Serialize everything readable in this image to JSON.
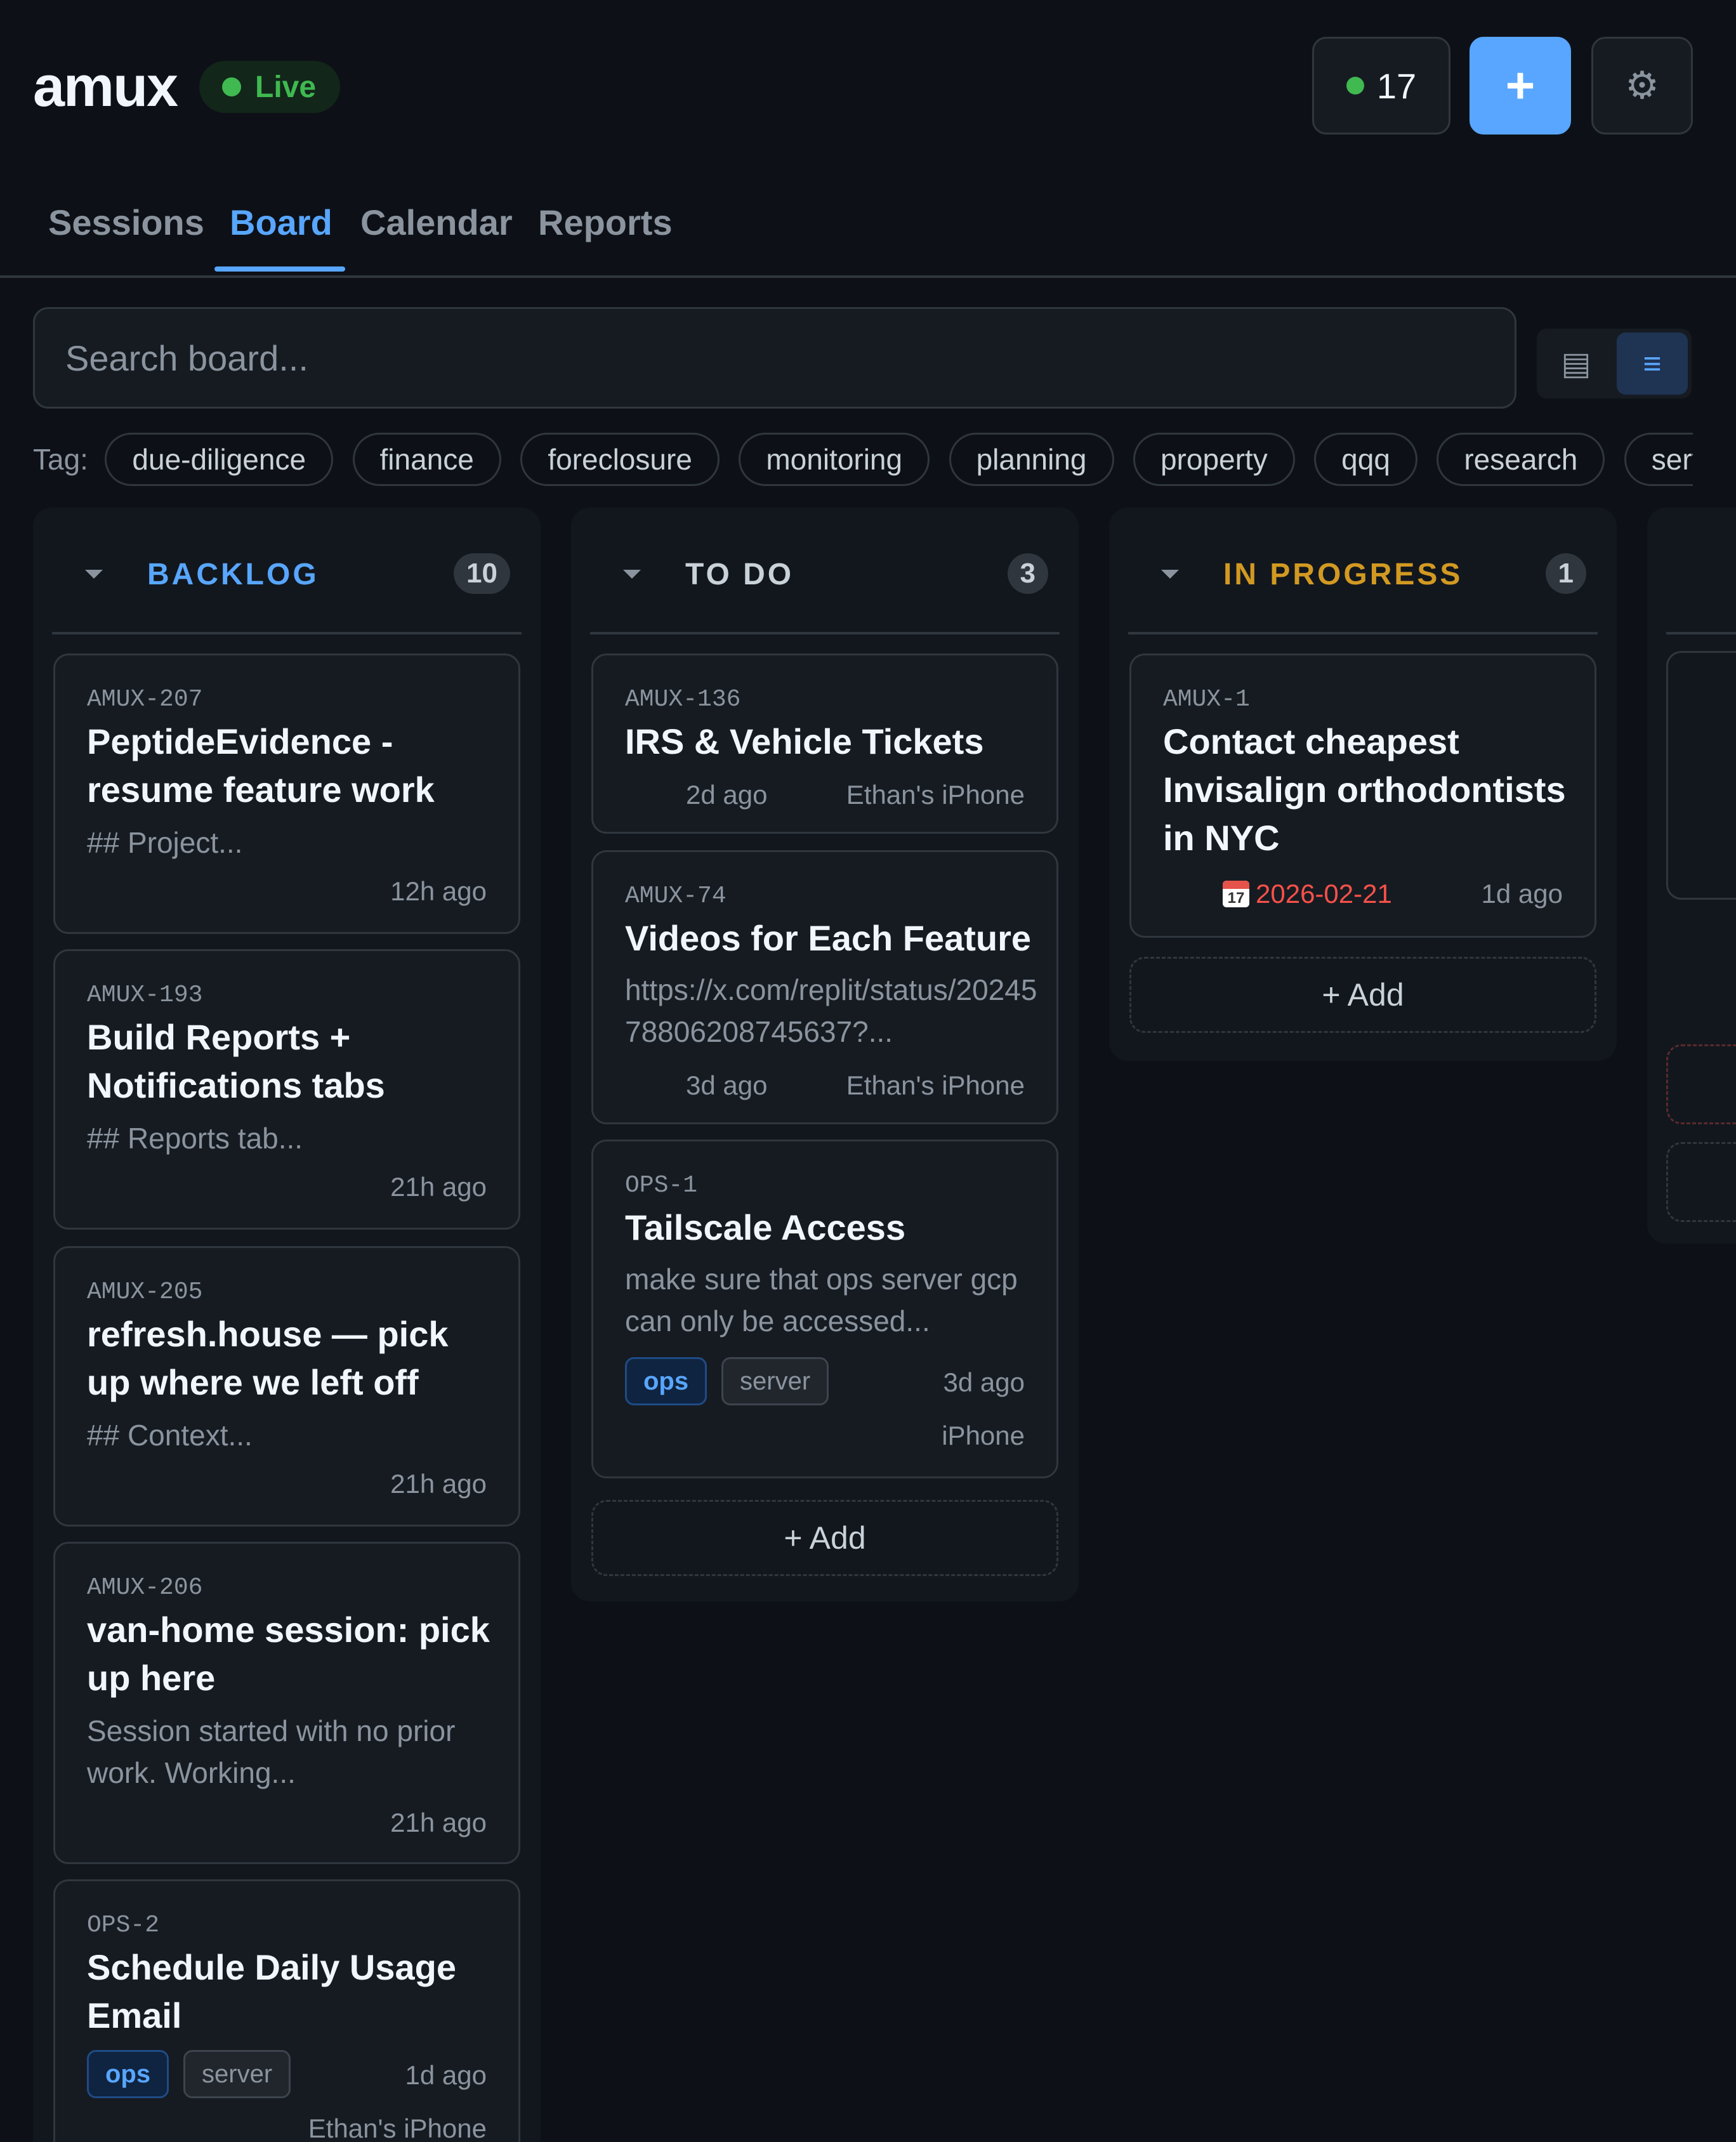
{
  "app": {
    "brand": "amux",
    "live_label": "Live",
    "active_count": "17",
    "add_label": "+",
    "settings_icon": "gear-icon"
  },
  "tabs": [
    {
      "label": "Sessions",
      "active": false
    },
    {
      "label": "Board",
      "active": true
    },
    {
      "label": "Calendar",
      "active": false
    },
    {
      "label": "Reports",
      "active": false
    }
  ],
  "search": {
    "placeholder": "Search board...",
    "value": ""
  },
  "view_toggle": {
    "grid_icon": "grid-icon",
    "list_icon": "list-icon",
    "selected": "list"
  },
  "tag_filter": {
    "label": "Tag:",
    "tags": [
      "due-diligence",
      "finance",
      "foreclosure",
      "monitoring",
      "planning",
      "property",
      "qqq",
      "research",
      "serve"
    ]
  },
  "colors": {
    "accent": "#58a6ff",
    "live": "#3fb950",
    "backlog": "#58a6ff",
    "todo": "#c9d1d9",
    "in_progress": "#d29922",
    "due_date": "#f85149"
  },
  "columns": [
    {
      "title": "BACKLOG",
      "count": "10",
      "cards": [
        {
          "id": "AMUX-207",
          "title": "PeptideEvidence - resume feature work",
          "desc": "## Project...",
          "time": "12h ago"
        },
        {
          "id": "AMUX-193",
          "title": "Build Reports + Notifications tabs",
          "desc": "## Reports tab...",
          "time": "21h ago"
        },
        {
          "id": "AMUX-205",
          "title": "refresh.house — pick up where we left off",
          "desc": "## Context...",
          "time": "21h ago"
        },
        {
          "id": "AMUX-206",
          "title": "van-home session: pick up here",
          "desc": "Session started with no prior work. Working...",
          "time": "21h ago"
        },
        {
          "id": "OPS-2",
          "title": "Schedule Daily Usage Email",
          "tags": [
            "ops",
            "server"
          ],
          "time": "1d ago",
          "device": "Ethan's iPhone"
        }
      ]
    },
    {
      "title": "TO DO",
      "count": "3",
      "cards": [
        {
          "id": "AMUX-136",
          "title": "IRS & Vehicle Tickets",
          "time": "2d ago",
          "device": "Ethan's iPhone"
        },
        {
          "id": "AMUX-74",
          "title": "Videos for Each Feature",
          "desc": "https://x.com/replit/status/2024578806208745637?...",
          "time": "3d ago",
          "device": "Ethan's iPhone"
        },
        {
          "id": "OPS-1",
          "title": "Tailscale Access",
          "desc": "make sure that ops server gcp can only be accessed...",
          "tags": [
            "ops",
            "server"
          ],
          "time": "3d ago",
          "device": "iPhone"
        }
      ],
      "add_label": "+ Add"
    },
    {
      "title": "IN PROGRESS",
      "count": "1",
      "cards": [
        {
          "id": "AMUX-1",
          "title": "Contact cheapest Invisalign orthodontists in NYC",
          "due": "2026-02-21",
          "due_icon_day": "17",
          "time": "1d ago"
        }
      ],
      "add_label": "+ Add"
    }
  ]
}
